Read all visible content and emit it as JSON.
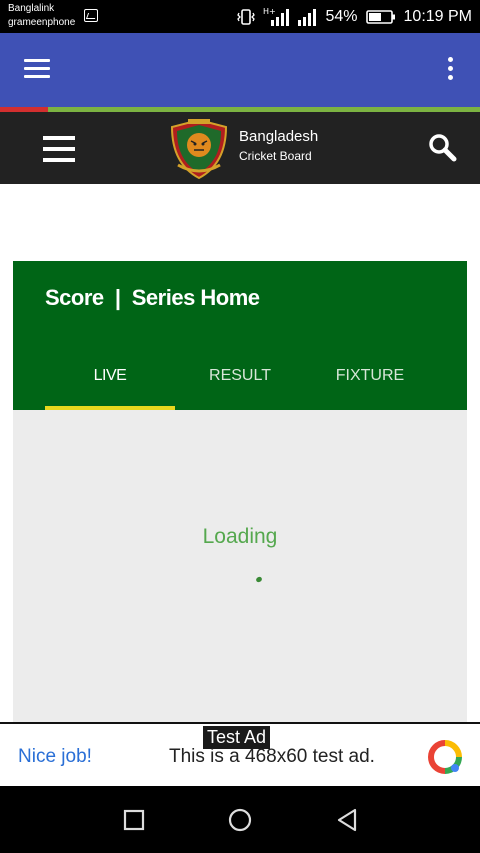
{
  "status_bar": {
    "carrier_1": "Banglalink",
    "carrier_2": "grameenphone",
    "network_type": "H+",
    "battery": "54%",
    "time": "10:19 PM",
    "icons": [
      "image-icon",
      "vibrate-icon",
      "signal-icon",
      "battery-icon"
    ]
  },
  "app_bar": {
    "menu_icon": "hamburger-icon",
    "overflow_icon": "kebab-icon",
    "color": "#3f51b5"
  },
  "site_header": {
    "brand_line_1": "Bangladesh",
    "brand_line_2": "Cricket Board",
    "menu_icon": "hamburger-icon",
    "search_icon": "search-icon"
  },
  "score_widget": {
    "title": "Score  |  Series Home",
    "tabs": [
      {
        "label": "LIVE",
        "active": true
      },
      {
        "label": "RESULT",
        "active": false
      },
      {
        "label": "FIXTURE",
        "active": false
      }
    ],
    "loading_text": "Loading",
    "header_color": "#006516",
    "indicator_color": "#e8d81e"
  },
  "ad": {
    "tag": "Test Ad",
    "cta": "Nice job!",
    "text": "This is a 468x60 test ad."
  },
  "nav_bar": {
    "buttons": [
      "recents-icon",
      "home-icon",
      "back-icon"
    ]
  }
}
